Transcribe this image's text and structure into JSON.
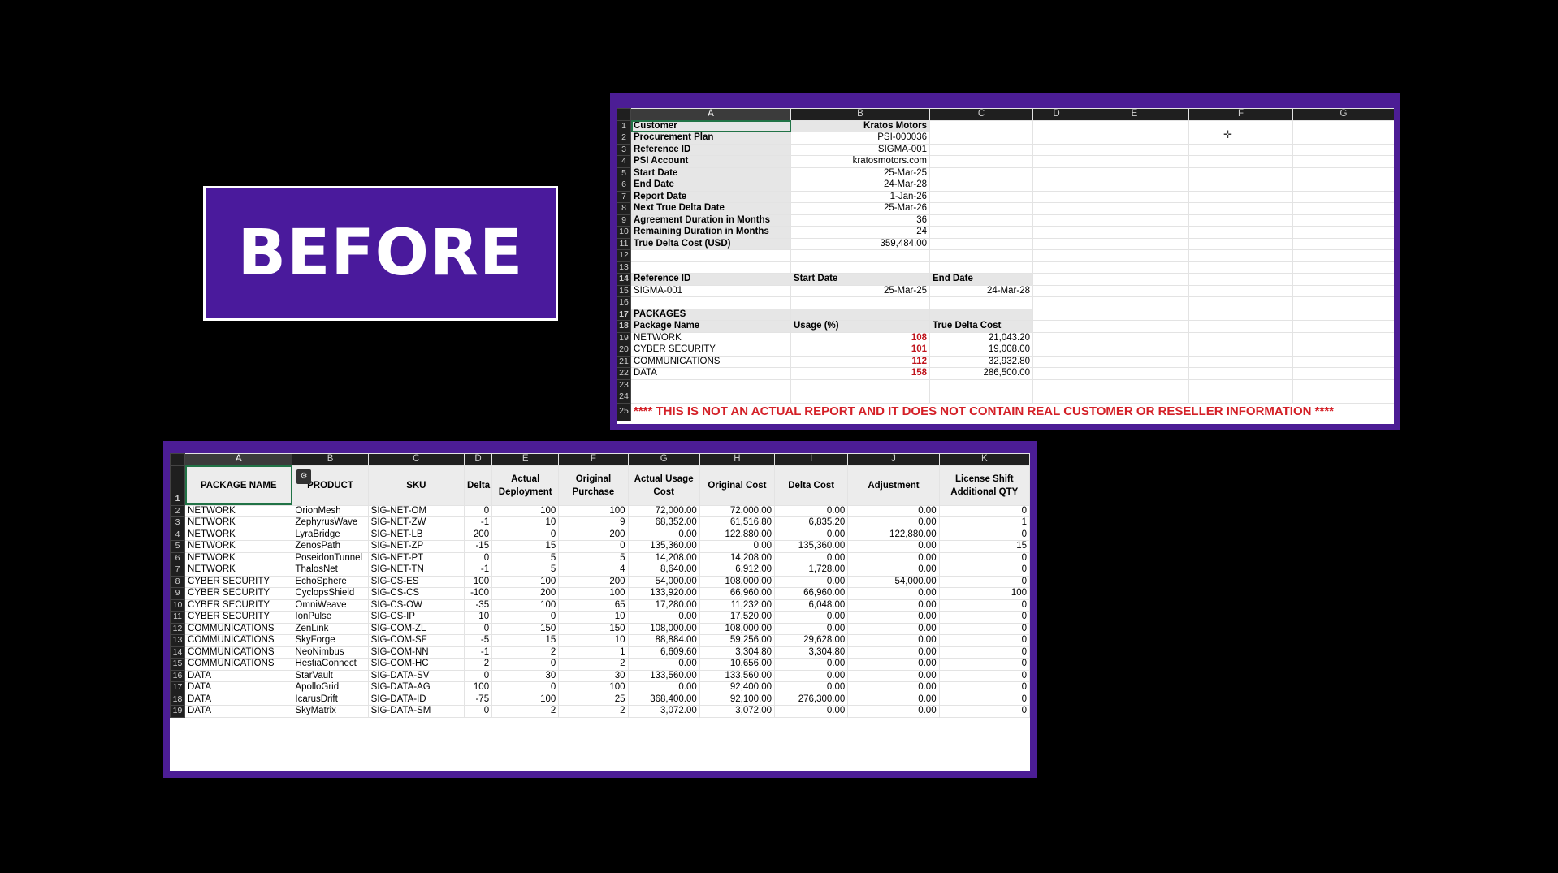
{
  "badge": {
    "label": "BEFORE"
  },
  "top_sheet": {
    "columns": [
      "A",
      "B",
      "C",
      "D",
      "E",
      "F",
      "G"
    ],
    "info": [
      {
        "row": "1",
        "label": "Customer",
        "value": "Kratos Motors"
      },
      {
        "row": "2",
        "label": "Procurement Plan",
        "value": "PSI-000036"
      },
      {
        "row": "3",
        "label": "Reference ID",
        "value": "SIGMA-001"
      },
      {
        "row": "4",
        "label": "PSI Account",
        "value": "kratosmotors.com"
      },
      {
        "row": "5",
        "label": "Start Date",
        "value": "25-Mar-25"
      },
      {
        "row": "6",
        "label": "End Date",
        "value": "24-Mar-28"
      },
      {
        "row": "7",
        "label": "Report Date",
        "value": "1-Jan-26"
      },
      {
        "row": "8",
        "label": "Next True Delta Date",
        "value": "25-Mar-26"
      },
      {
        "row": "9",
        "label": "Agreement Duration in Months",
        "value": "36"
      },
      {
        "row": "10",
        "label": "Remaining Duration in Months",
        "value": "24"
      },
      {
        "row": "11",
        "label": "True Delta Cost (USD)",
        "value": "359,484.00"
      }
    ],
    "empty_rows": [
      "12",
      "13"
    ],
    "ref_header": {
      "row": "14",
      "a": "Reference ID",
      "b": "Start Date",
      "c": "End Date"
    },
    "ref_row": {
      "row": "15",
      "a": "SIGMA-001",
      "b": "25-Mar-25",
      "c": "24-Mar-28"
    },
    "row16": "16",
    "packages_title": {
      "row": "17",
      "label": "PACKAGES"
    },
    "packages_header": {
      "row": "18",
      "a": "Package Name",
      "b": "Usage (%)",
      "c": "True Delta Cost"
    },
    "packages": [
      {
        "row": "19",
        "name": "NETWORK",
        "usage": "108",
        "cost": "21,043.20"
      },
      {
        "row": "20",
        "name": "CYBER SECURITY",
        "usage": "101",
        "cost": "19,008.00"
      },
      {
        "row": "21",
        "name": "COMMUNICATIONS",
        "usage": "112",
        "cost": "32,932.80"
      },
      {
        "row": "22",
        "name": "DATA",
        "usage": "158",
        "cost": "286,500.00"
      }
    ],
    "tail_rows": [
      "23",
      "24"
    ],
    "warning": {
      "row": "25",
      "text": "**** THIS IS NOT AN ACTUAL REPORT AND IT DOES NOT CONTAIN REAL CUSTOMER OR RESELLER INFORMATION ****"
    },
    "colors": {
      "red": "#c0141c",
      "frame": "#4c1d95"
    }
  },
  "bottom_sheet": {
    "columns": [
      "A",
      "B",
      "C",
      "D",
      "E",
      "F",
      "G",
      "H",
      "I",
      "J",
      "K"
    ],
    "headers": [
      "PACKAGE NAME",
      "PRODUCT",
      "SKU",
      "Delta",
      "Actual Deployment",
      "Original Purchase",
      "Actual Usage Cost",
      "Original Cost",
      "Delta Cost",
      "Adjustment",
      "License Shift Additional QTY"
    ],
    "rows": [
      {
        "n": "2",
        "c": [
          "NETWORK",
          "OrionMesh",
          "SIG-NET-OM",
          "0",
          "100",
          "100",
          "72,000.00",
          "72,000.00",
          "0.00",
          "0.00",
          "0"
        ]
      },
      {
        "n": "3",
        "c": [
          "NETWORK",
          "ZephyrusWave",
          "SIG-NET-ZW",
          "-1",
          "10",
          "9",
          "68,352.00",
          "61,516.80",
          "6,835.20",
          "0.00",
          "1"
        ]
      },
      {
        "n": "4",
        "c": [
          "NETWORK",
          "LyraBridge",
          "SIG-NET-LB",
          "200",
          "0",
          "200",
          "0.00",
          "122,880.00",
          "0.00",
          "122,880.00",
          "0"
        ]
      },
      {
        "n": "5",
        "c": [
          "NETWORK",
          "ZenosPath",
          "SIG-NET-ZP",
          "-15",
          "15",
          "0",
          "135,360.00",
          "0.00",
          "135,360.00",
          "0.00",
          "15"
        ]
      },
      {
        "n": "6",
        "c": [
          "NETWORK",
          "PoseidonTunnel",
          "SIG-NET-PT",
          "0",
          "5",
          "5",
          "14,208.00",
          "14,208.00",
          "0.00",
          "0.00",
          "0"
        ]
      },
      {
        "n": "7",
        "c": [
          "NETWORK",
          "ThalosNet",
          "SIG-NET-TN",
          "-1",
          "5",
          "4",
          "8,640.00",
          "6,912.00",
          "1,728.00",
          "0.00",
          "0"
        ]
      },
      {
        "n": "8",
        "c": [
          "CYBER SECURITY",
          "EchoSphere",
          "SIG-CS-ES",
          "100",
          "100",
          "200",
          "54,000.00",
          "108,000.00",
          "0.00",
          "54,000.00",
          "0"
        ]
      },
      {
        "n": "9",
        "c": [
          "CYBER SECURITY",
          "CyclopsShield",
          "SIG-CS-CS",
          "-100",
          "200",
          "100",
          "133,920.00",
          "66,960.00",
          "66,960.00",
          "0.00",
          "100"
        ]
      },
      {
        "n": "10",
        "c": [
          "CYBER SECURITY",
          "OmniWeave",
          "SIG-CS-OW",
          "-35",
          "100",
          "65",
          "17,280.00",
          "11,232.00",
          "6,048.00",
          "0.00",
          "0"
        ]
      },
      {
        "n": "11",
        "c": [
          "CYBER SECURITY",
          "IonPulse",
          "SIG-CS-IP",
          "10",
          "0",
          "10",
          "0.00",
          "17,520.00",
          "0.00",
          "0.00",
          "0"
        ]
      },
      {
        "n": "12",
        "c": [
          "COMMUNICATIONS",
          "ZenLink",
          "SIG-COM-ZL",
          "0",
          "150",
          "150",
          "108,000.00",
          "108,000.00",
          "0.00",
          "0.00",
          "0"
        ]
      },
      {
        "n": "13",
        "c": [
          "COMMUNICATIONS",
          "SkyForge",
          "SIG-COM-SF",
          "-5",
          "15",
          "10",
          "88,884.00",
          "59,256.00",
          "29,628.00",
          "0.00",
          "0"
        ]
      },
      {
        "n": "14",
        "c": [
          "COMMUNICATIONS",
          "NeoNimbus",
          "SIG-COM-NN",
          "-1",
          "2",
          "1",
          "6,609.60",
          "3,304.80",
          "3,304.80",
          "0.00",
          "0"
        ]
      },
      {
        "n": "15",
        "c": [
          "COMMUNICATIONS",
          "HestiaConnect",
          "SIG-COM-HC",
          "2",
          "0",
          "2",
          "0.00",
          "10,656.00",
          "0.00",
          "0.00",
          "0"
        ]
      },
      {
        "n": "16",
        "c": [
          "DATA",
          "StarVault",
          "SIG-DATA-SV",
          "0",
          "30",
          "30",
          "133,560.00",
          "133,560.00",
          "0.00",
          "0.00",
          "0"
        ]
      },
      {
        "n": "17",
        "c": [
          "DATA",
          "ApolloGrid",
          "SIG-DATA-AG",
          "100",
          "0",
          "100",
          "0.00",
          "92,400.00",
          "0.00",
          "0.00",
          "0"
        ]
      },
      {
        "n": "18",
        "c": [
          "DATA",
          "IcarusDrift",
          "SIG-DATA-ID",
          "-75",
          "100",
          "25",
          "368,400.00",
          "92,100.00",
          "276,300.00",
          "0.00",
          "0"
        ]
      },
      {
        "n": "19",
        "c": [
          "DATA",
          "SkyMatrix",
          "SIG-DATA-SM",
          "0",
          "2",
          "2",
          "3,072.00",
          "3,072.00",
          "0.00",
          "0.00",
          "0"
        ]
      }
    ]
  }
}
